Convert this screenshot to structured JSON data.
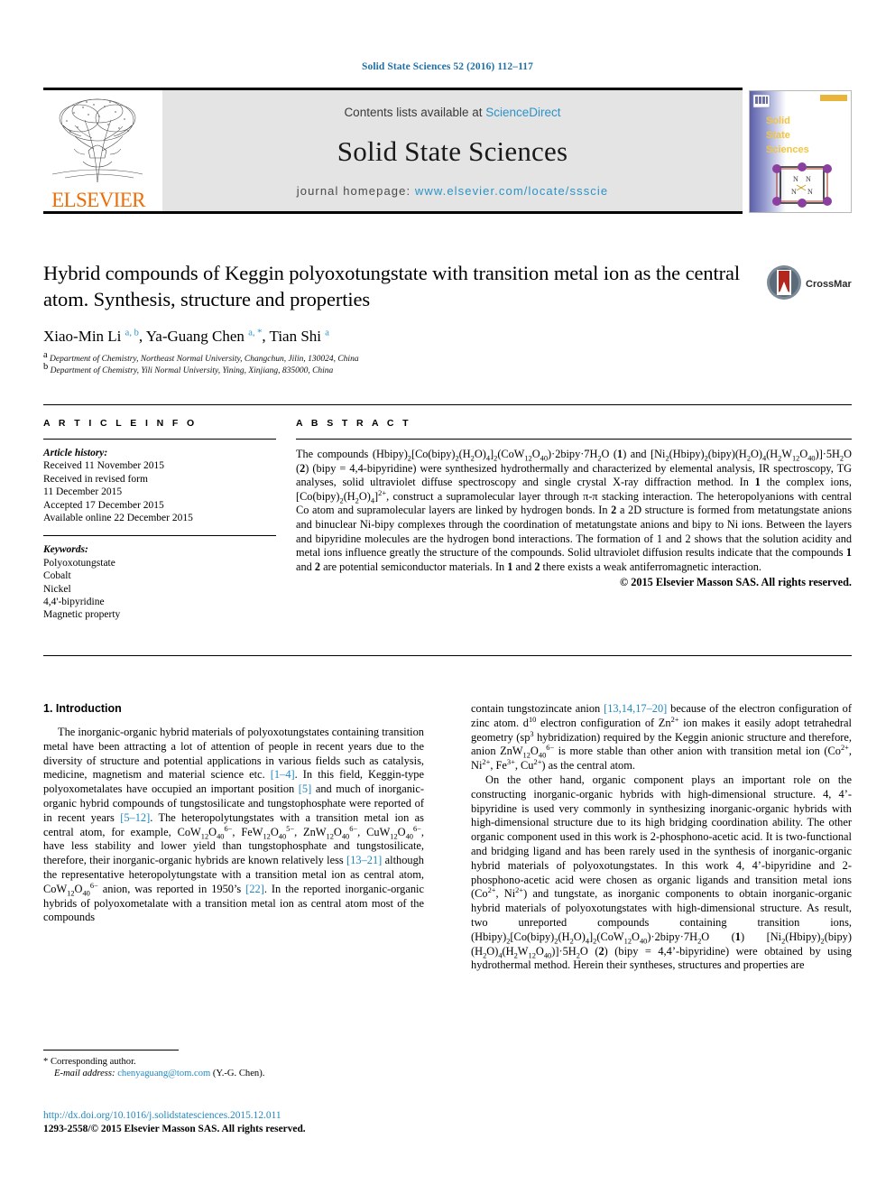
{
  "running_head": "Solid State Sciences 52 (2016) 112–117",
  "masthead": {
    "contents_prefix": "Contents lists available at ",
    "sciencedirect": "ScienceDirect",
    "journal_name": "Solid State Sciences",
    "homepage_prefix": "journal homepage: ",
    "homepage_url": "www.elsevier.com/locate/ssscie",
    "publisher_wordmark": "ELSEVIER",
    "publisher_logo_icon": "elsevier-tree-logo",
    "cover_title_lines": [
      "Solid",
      "State",
      "Sciences"
    ],
    "accent_link_color": "#2b93c8",
    "panel_color": "#e4e4e4",
    "elsevier_orange": "#eb6e08"
  },
  "article": {
    "title": "Hybrid compounds of Keggin polyoxotungstate with transition metal ion as the central atom. Synthesis, structure and properties",
    "authors_html": "Xiao-Min Li <sup>a, b</sup>, Ya-Guang Chen <sup>a, *</sup>, Tian Shi <sup>a</sup>",
    "affiliations": [
      {
        "marker": "a",
        "text": "Department of Chemistry, Northeast Normal University, Changchun, Jilin, 130024, China"
      },
      {
        "marker": "b",
        "text": "Department of Chemistry, Yili Normal University, Yining, Xinjiang, 835000, China"
      }
    ],
    "crossmark_label": "CrossMark"
  },
  "article_info": {
    "heading": "A R T I C L E  I N F O",
    "history_label": "Article history:",
    "history": [
      "Received 11 November 2015",
      "Received in revised form",
      "11 December 2015",
      "Accepted 17 December 2015",
      "Available online 22 December 2015"
    ],
    "keywords_label": "Keywords:",
    "keywords": [
      "Polyoxotungstate",
      "Cobalt",
      "Nickel",
      "4,4'-bipyridine",
      "Magnetic property"
    ]
  },
  "abstract": {
    "heading": "A B S T R A C T",
    "body_html": "The compounds (Hbipy)<sub>2</sub>[Co(bipy)<sub>2</sub>(H<sub>2</sub>O)<sub>4</sub>]<sub>2</sub>(CoW<sub>12</sub>O<sub>40</sub>)&middot;2bipy&middot;7H<sub>2</sub>O (<b>1</b>) and [Ni<sub>2</sub>(Hbipy)<sub>2</sub>(bipy)(H<sub>2</sub>O)<sub>4</sub>(H<sub>2</sub>W<sub>12</sub>O<sub>40</sub>)]&middot;5H<sub>2</sub>O (<b>2</b>) (bipy = 4,4-bipyridine) were synthesized hydrothermally and characterized by elemental analysis, IR spectroscopy, TG analyses, solid ultraviolet diffuse spectroscopy and single crystal X-ray diffraction method. In <b>1</b> the complex ions, [Co(bipy)<sub>2</sub>(H<sub>2</sub>O)<sub>4</sub>]<sup>2+</sup>, construct a supramolecular layer through &pi;-&pi; stacking interaction. The heteropolyanions with central Co atom and supramolecular layers are linked by hydrogen bonds. In <b>2</b> a 2D structure is formed from metatungstate anions and binuclear Ni-bipy complexes through the coordination of metatungstate anions and bipy to Ni ions. Between the layers and bipyridine molecules are the hydrogen bond interactions. The formation of 1 and 2 shows that the solution acidity and metal ions influence greatly the structure of the compounds. Solid ultraviolet diffusion results indicate that the compounds <b>1</b> and <b>2</b> are potential semiconductor materials. In <b>1</b> and <b>2</b> there exists a weak antiferromagnetic interaction.",
    "copyright": "© 2015 Elsevier Masson SAS. All rights reserved."
  },
  "body": {
    "section_heading": "1. Introduction",
    "left_paragraphs_html": [
      "The inorganic-organic hybrid materials of polyoxotungstates containing transition metal have been attracting a lot of attention of people in recent years due to the diversity of structure and potential applications in various fields such as catalysis, medicine, magnetism and material science etc. <span class=\"ref\">[1&ndash;4]</span>. In this field, Keggin-type polyoxometalates have occupied an important position <span class=\"ref\">[5]</span> and much of inorganic-organic hybrid compounds of tungstosilicate and tungstophosphate were reported of in recent years <span class=\"ref\">[5&ndash;12]</span>. The heteropolytungstates with a transition metal ion as central atom, for example, CoW<sub>12</sub>O<sub>40</sub><sup>6&minus;</sup>, FeW<sub>12</sub>O<sub>40</sub><sup>5&minus;</sup>, ZnW<sub>12</sub>O<sub>40</sub><sup>6&minus;</sup>, CuW<sub>12</sub>O<sub>40</sub><sup>6&minus;</sup>, have less stability and lower yield than tungstophosphate and tungstosilicate, therefore, their inorganic-organic hybrids are known relatively less <span class=\"ref\">[13&ndash;21]</span> although the representative heteropolytungstate with a transition metal ion as central atom, CoW<sub>12</sub>O<sub>40</sub><sup>6&minus;</sup> anion, was reported in 1950&#8217;s <span class=\"ref\">[22]</span>. In the reported inorganic-organic hybrids of polyoxometalate with a transition metal ion as central atom most of the compounds"
    ],
    "right_paragraphs_html": [
      "contain tungstozincate anion <span class=\"ref\">[13,14,17&ndash;20]</span> because of the electron configuration of zinc atom. d<sup>10</sup> electron configuration of Zn<sup>2+</sup> ion makes it easily adopt tetrahedral geometry (sp<sup>3</sup> hybridization) required by the Keggin anionic structure and therefore, anion ZnW<sub>12</sub>O<sub>40</sub><sup>6&minus;</sup> is more stable than other anion with transition metal ion (Co<sup>2+</sup>, Ni<sup>2+</sup>, Fe<sup>3+</sup>, Cu<sup>2+</sup>) as the central atom.",
      "On the other hand, organic component plays an important role on the constructing inorganic-organic hybrids with high-dimensional structure. 4, 4&#8217;-bipyridine is used very commonly in synthesizing inorganic-organic hybrids with high-dimensional structure due to its high bridging coordination ability. The other organic component used in this work is 2-phosphono-acetic acid. It is two-functional and bridging ligand and has been rarely used in the synthesis of inorganic-organic hybrid materials of polyoxotungstates. In this work 4, 4&#8217;-bipyridine and 2-phosphono-acetic acid were chosen as organic ligands and transition metal ions (Co<sup>2+</sup>, Ni<sup>2+</sup>) and tungstate, as inorganic components to obtain inorganic-organic hybrid materials of polyoxotungstates with high-dimensional structure. As result, two unreported compounds containing transition ions, (Hbipy)<sub>2</sub>[Co(bipy)<sub>2</sub>(H<sub>2</sub>O)<sub>4</sub>]<sub>2</sub>(CoW<sub>12</sub>O<sub>40</sub>)&middot;2bipy&middot;7H<sub>2</sub>O (<b>1</b>) [Ni<sub>2</sub>(Hbipy)<sub>2</sub>(bipy)(H<sub>2</sub>O)<sub>4</sub>(H<sub>2</sub>W<sub>12</sub>O<sub>40</sub>)]&middot;5H<sub>2</sub>O (<b>2</b>) (bipy = 4,4&#8217;-bipyridine) were obtained by using hydrothermal method. Herein their syntheses, structures and properties are"
    ]
  },
  "footer": {
    "corresponding_marker": "*",
    "corresponding_label": "Corresponding author.",
    "email_label": "E-mail address:",
    "email": "chenyaguang@tom.com",
    "email_suffix": "(Y.-G. Chen).",
    "doi_url": "http://dx.doi.org/10.1016/j.solidstatesciences.2015.12.011",
    "issn_line": "1293-2558/© 2015 Elsevier Masson SAS. All rights reserved."
  }
}
